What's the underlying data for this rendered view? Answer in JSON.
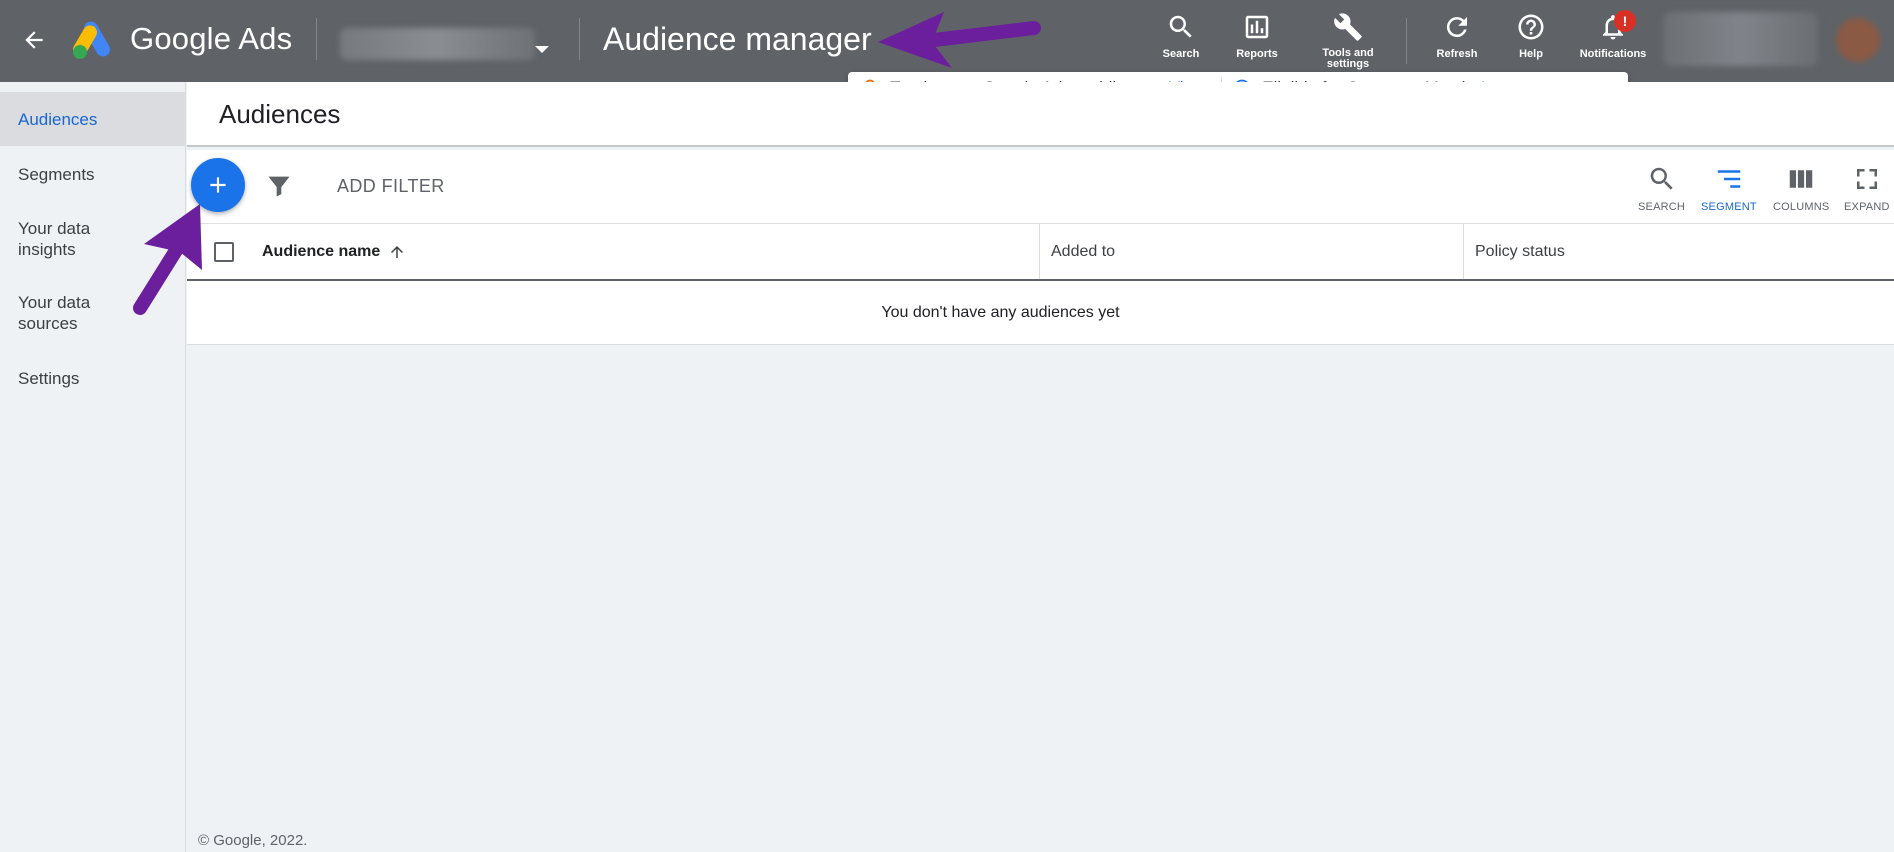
{
  "app": {
    "brand": "Google Ads",
    "page_title": "Audience manager"
  },
  "toolbar": {
    "search": "Search",
    "reports": "Reports",
    "tools": "Tools and settings",
    "refresh": "Refresh",
    "help": "Help",
    "notifications": "Notifications",
    "notification_badge": "!"
  },
  "notice": {
    "app_text": "Try the new Google Ads mobile app",
    "app_link": "View",
    "match_text": "Eligible for Customer Match",
    "match_link": "Learn more",
    "close": "×"
  },
  "sidebar": {
    "items": [
      {
        "label": "Audiences"
      },
      {
        "label": "Segments"
      },
      {
        "label": "Your data insights"
      },
      {
        "label": "Your data sources"
      },
      {
        "label": "Settings"
      }
    ]
  },
  "main": {
    "heading": "Audiences",
    "add_filter": "ADD FILTER",
    "table_tools": {
      "search": "SEARCH",
      "segment": "SEGMENT",
      "columns": "COLUMNS",
      "expand": "EXPAND"
    },
    "columns": [
      "Audience name",
      "Added to",
      "Policy status"
    ],
    "empty_message": "You don't have any audiences yet"
  },
  "footer": "© Google, 2022.",
  "colors": {
    "topbar": "#5f6368",
    "accent": "#1a73e8",
    "annotation": "#6b1f9c"
  }
}
